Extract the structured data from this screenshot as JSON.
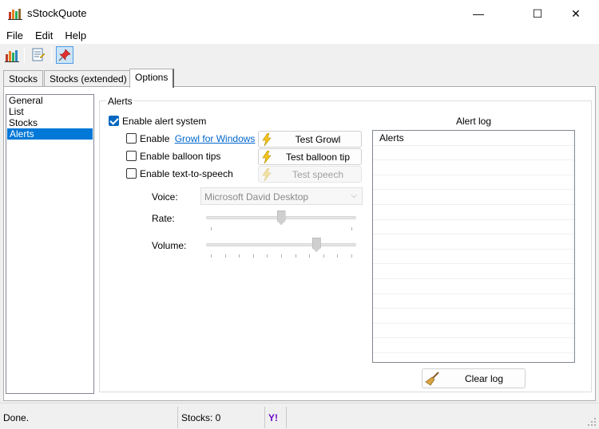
{
  "window": {
    "title": "sStockQuote",
    "minimize_glyph": "—",
    "maximize_glyph": "☐",
    "close_glyph": "✕"
  },
  "menu": [
    "File",
    "Edit",
    "Help"
  ],
  "toolbar": {
    "icons": [
      "bar-chart-icon",
      "document-list-icon",
      "pin-icon"
    ],
    "pressed": "pin-icon"
  },
  "tabs": [
    "Stocks",
    "Stocks (extended)",
    "Options"
  ],
  "active_tab": "Options",
  "options_nav": {
    "items": [
      "General",
      "List",
      "Stocks",
      "Alerts"
    ],
    "selected": "Alerts"
  },
  "alerts": {
    "group_label": "Alerts",
    "enable_alert_system": {
      "label": "Enable alert system",
      "checked": true
    },
    "growl": {
      "label_prefix": "Enable",
      "link": "Growl for Windows",
      "checked": false,
      "button": "Test Growl"
    },
    "balloon": {
      "label": "Enable balloon tips",
      "checked": false,
      "button": "Test balloon tip"
    },
    "tts": {
      "label": "Enable text-to-speech",
      "checked": false,
      "button": "Test speech"
    },
    "voice": {
      "label": "Voice:",
      "value": "Microsoft David Desktop"
    },
    "rate": {
      "label": "Rate:",
      "level": 0.5
    },
    "volume": {
      "label": "Volume:",
      "level": 0.75
    }
  },
  "alert_log": {
    "title": "Alert log",
    "rows": [
      "Alerts"
    ],
    "clear_button": "Clear log"
  },
  "status": {
    "text": "Done.",
    "stocks": "Stocks: 0",
    "provider_logo": "Y!"
  },
  "colors": {
    "accent": "#0078d7",
    "checkbox_checked": "#0067c0",
    "link": "#0066cc",
    "yahoo": "#6b0ac9"
  }
}
